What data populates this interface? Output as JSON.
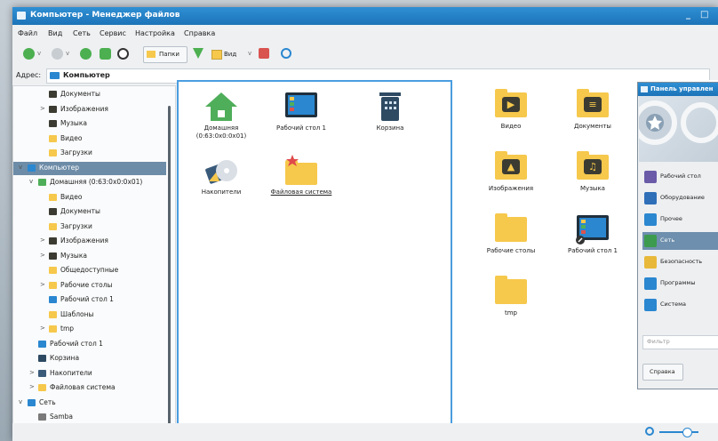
{
  "window": {
    "title": "Компьютер - Менеджер файлов",
    "controls": [
      "_",
      "□"
    ]
  },
  "menu": [
    "Файл",
    "Вид",
    "Сеть",
    "Сервис",
    "Настройка",
    "Справка"
  ],
  "toolbar": {
    "folders_label": "Папки",
    "view_label": "Вид"
  },
  "address": {
    "label": "Адрес:",
    "value": "Компьютер"
  },
  "tree": [
    {
      "label": "Документы",
      "color": "#3b3b32"
    },
    {
      "label": "Изображения",
      "color": "#3b3b32",
      "expander": ">"
    },
    {
      "label": "Музыка",
      "color": "#3b3b32"
    },
    {
      "label": "Видео",
      "color": "#f6c84c"
    },
    {
      "label": "Загрузки",
      "color": "#f6c84c"
    },
    {
      "label": "Компьютер",
      "color": "#2a87d0",
      "expander": "v",
      "selected": true
    },
    {
      "label": "Домашняя (0:63:0x0:0x01)",
      "color": "#4fae5a",
      "expander": "v"
    },
    {
      "label": "Видео",
      "color": "#f6c84c"
    },
    {
      "label": "Документы",
      "color": "#3b3b32"
    },
    {
      "label": "Загрузки",
      "color": "#f6c84c"
    },
    {
      "label": "Изображения",
      "color": "#3b3b32",
      "expander": ">"
    },
    {
      "label": "Музыка",
      "color": "#3b3b32",
      "expander": ">"
    },
    {
      "label": "Общедоступные",
      "color": "#f6c84c"
    },
    {
      "label": "Рабочие столы",
      "color": "#f6c84c",
      "expander": ">"
    },
    {
      "label": "Рабочий стол 1",
      "color": "#2a87d0"
    },
    {
      "label": "Шаблоны",
      "color": "#f6c84c"
    },
    {
      "label": "tmp",
      "color": "#f6c84c",
      "expander": ">"
    },
    {
      "label": "Рабочий стол 1",
      "color": "#2a87d0"
    },
    {
      "label": "Корзина",
      "color": "#2e4a63"
    },
    {
      "label": "Накопители",
      "color": "#3a5a7a",
      "expander": ">"
    },
    {
      "label": "Файловая система",
      "color": "#f6c84c",
      "expander": ">"
    },
    {
      "label": "Сеть",
      "color": "#2a87d0",
      "expander": "v"
    },
    {
      "label": "Samba",
      "color": "#7a7a7a"
    }
  ],
  "pane_left": [
    {
      "label": "Домашняя (0:63:0x0:0x01)",
      "icon": "home-icon"
    },
    {
      "label": "Рабочий стол 1",
      "icon": "desktop-icon"
    },
    {
      "label": "Корзина",
      "icon": "trash-icon"
    },
    {
      "label": "Накопители",
      "icon": "drives-icon"
    },
    {
      "label": "Файловая система",
      "icon": "filesystem-icon"
    }
  ],
  "pane_right": [
    {
      "label": "Видео",
      "icon": "video-folder-icon",
      "glyph": "▶"
    },
    {
      "label": "Документы",
      "icon": "documents-folder-icon",
      "glyph": "≡"
    },
    {
      "label": "Изображения",
      "icon": "pictures-folder-icon",
      "glyph": "▲"
    },
    {
      "label": "Музыка",
      "icon": "music-folder-icon",
      "glyph": "♫"
    },
    {
      "label": "Рабочие столы",
      "icon": "folder-icon",
      "glyph": ""
    },
    {
      "label": "Рабочий стол 1",
      "icon": "desktop-link-icon",
      "glyph": ""
    },
    {
      "label": "tmp",
      "icon": "folder-icon",
      "glyph": ""
    }
  ],
  "control_panel": {
    "title": "Панель управлен",
    "items": [
      {
        "label": "Рабочий стол",
        "color": "#6a5aa8"
      },
      {
        "label": "Оборудование",
        "color": "#2e6fb8"
      },
      {
        "label": "Прочее",
        "color": "#2a87d0"
      },
      {
        "label": "Сеть",
        "color": "#3c9b4e",
        "selected": true
      },
      {
        "label": "Безопасность",
        "color": "#e8b83a"
      },
      {
        "label": "Программы",
        "color": "#2a87d0"
      },
      {
        "label": "Система",
        "color": "#2a87d0"
      }
    ],
    "filter_placeholder": "Фильтр",
    "help_label": "Справка"
  },
  "colors": {
    "accent": "#1d74b8",
    "selection": "#6d8ca7",
    "folder": "#f6c84c"
  }
}
